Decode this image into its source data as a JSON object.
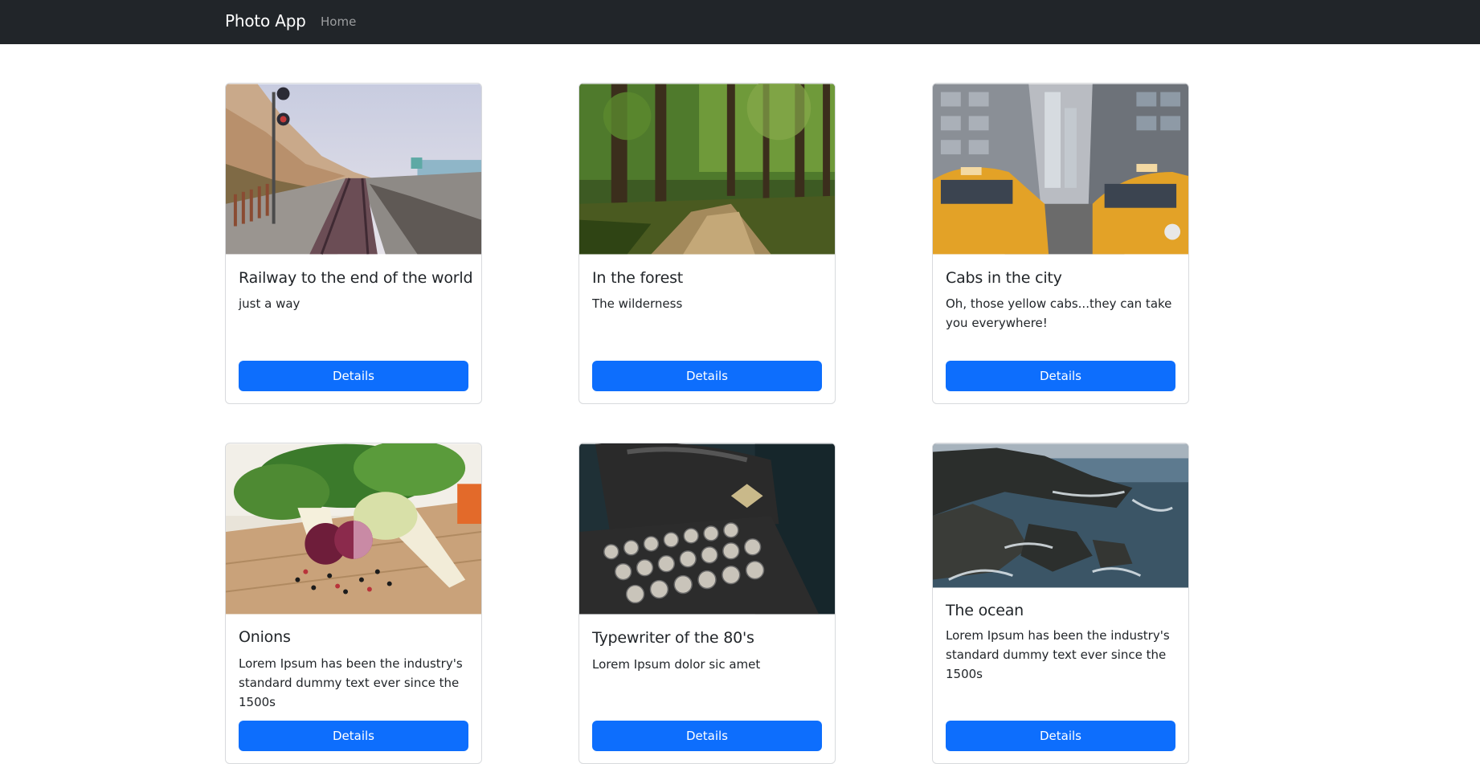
{
  "navbar": {
    "brand": "Photo App",
    "links": [
      {
        "label": "Home"
      }
    ]
  },
  "cards": [
    {
      "title": "Railway to the end of the world",
      "text": "just a way",
      "button": "Details",
      "image": "railway-photo"
    },
    {
      "title": "In the forest",
      "text": "The wilderness",
      "button": "Details",
      "image": "forest-photo"
    },
    {
      "title": "Cabs in the city",
      "text": "Oh, those yellow cabs...they can take you everywhere!",
      "button": "Details",
      "image": "taxi-photo"
    },
    {
      "title": "Onions",
      "text": "Lorem Ipsum has been the industry's standard dummy text ever since the 1500s",
      "button": "Details",
      "image": "onions-photo"
    },
    {
      "title": "Typewriter of the 80's",
      "text": "Lorem Ipsum dolor sic amet",
      "button": "Details",
      "image": "typewriter-photo"
    },
    {
      "title": "The ocean",
      "text": "Lorem Ipsum has been the industry's standard dummy text ever since the 1500s",
      "button": "Details",
      "image": "ocean-photo"
    }
  ],
  "colors": {
    "navbar_bg": "#212529",
    "button_bg": "#0d6efd",
    "card_border": "#d8dadd"
  }
}
